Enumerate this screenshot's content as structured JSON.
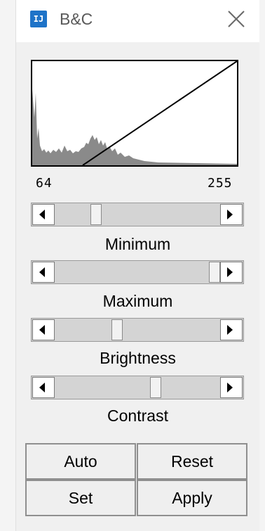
{
  "window": {
    "title": "B&C",
    "app_icon_text": "IJ"
  },
  "histogram": {
    "min_label": "64",
    "max_label": "255"
  },
  "sliders": [
    {
      "label": "Minimum",
      "position": 0.23
    },
    {
      "label": "Maximum",
      "position": 1.0
    },
    {
      "label": "Brightness",
      "position": 0.37
    },
    {
      "label": "Contrast",
      "position": 0.62
    }
  ],
  "buttons": {
    "auto": "Auto",
    "reset": "Reset",
    "set": "Set",
    "apply": "Apply"
  }
}
